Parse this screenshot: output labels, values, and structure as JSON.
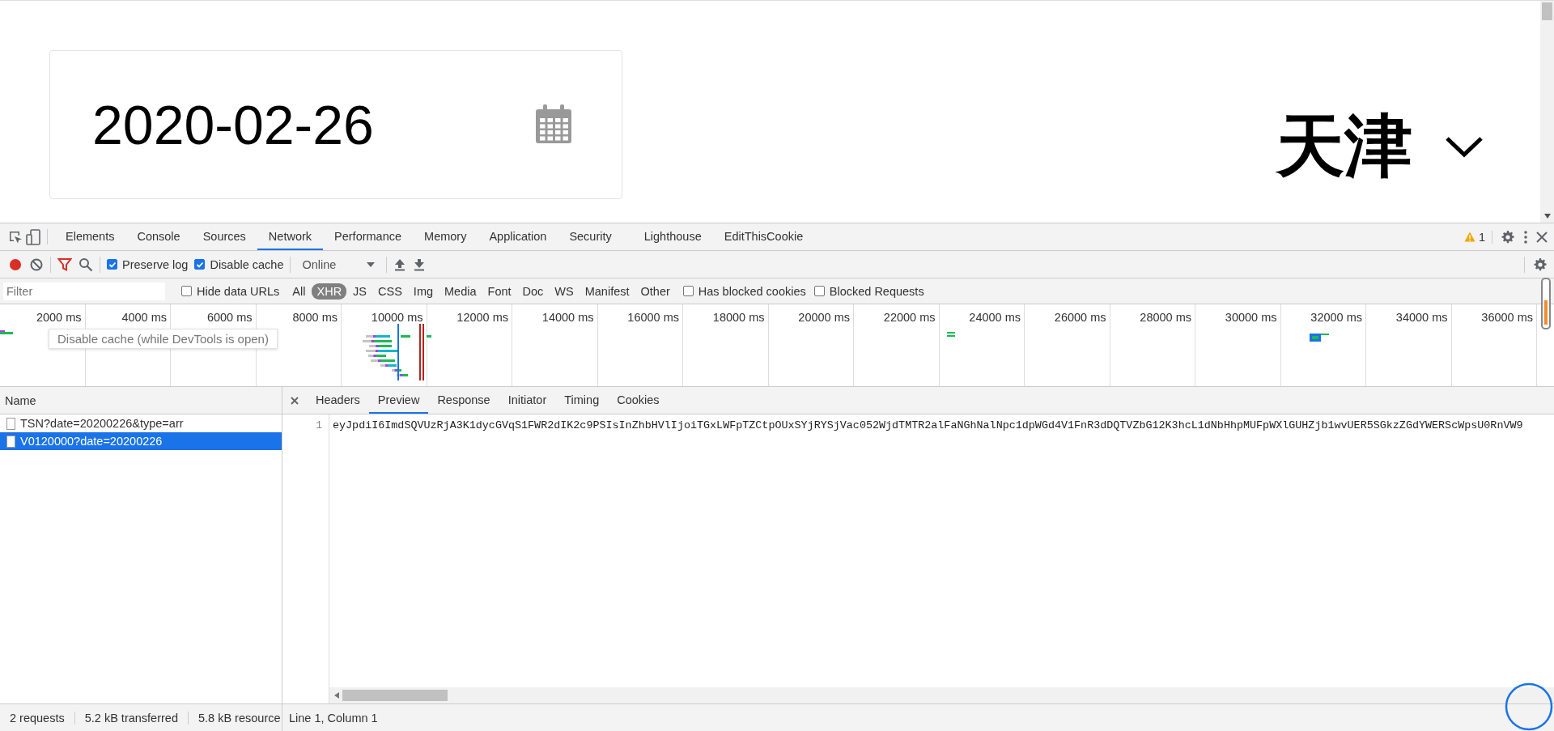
{
  "page": {
    "date_field": {
      "value": "2020-02-26"
    },
    "city_select": {
      "value": "天津"
    }
  },
  "devtools": {
    "tabs": [
      {
        "label": "Elements",
        "selected": false
      },
      {
        "label": "Console",
        "selected": false
      },
      {
        "label": "Sources",
        "selected": false
      },
      {
        "label": "Network",
        "selected": true
      },
      {
        "label": "Performance",
        "selected": false
      },
      {
        "label": "Memory",
        "selected": false
      },
      {
        "label": "Application",
        "selected": false
      },
      {
        "label": "Security",
        "selected": false
      },
      {
        "label": "Lighthouse",
        "selected": false
      },
      {
        "label": "EditThisCookie",
        "selected": false
      }
    ],
    "warning_count": "1",
    "toolbar": {
      "preserve_log": {
        "label": "Preserve log",
        "checked": true
      },
      "disable_cache": {
        "label": "Disable cache",
        "checked": true
      },
      "throttling": "Online"
    },
    "filter": {
      "placeholder": "Filter",
      "hide_data_urls": {
        "label": "Hide data URLs",
        "checked": false
      },
      "types": [
        {
          "label": "All",
          "selected": false
        },
        {
          "label": "XHR",
          "selected": true
        },
        {
          "label": "JS",
          "selected": false
        },
        {
          "label": "CSS",
          "selected": false
        },
        {
          "label": "Img",
          "selected": false
        },
        {
          "label": "Media",
          "selected": false
        },
        {
          "label": "Font",
          "selected": false
        },
        {
          "label": "Doc",
          "selected": false
        },
        {
          "label": "WS",
          "selected": false
        },
        {
          "label": "Manifest",
          "selected": false
        },
        {
          "label": "Other",
          "selected": false
        }
      ],
      "has_blocked_cookies": {
        "label": "Has blocked cookies",
        "checked": false
      },
      "blocked_requests": {
        "label": "Blocked Requests",
        "checked": false
      }
    },
    "tooltip": "Disable cache (while DevTools is open)",
    "overview": {
      "ticks": [
        "2000 ms",
        "4000 ms",
        "6000 ms",
        "8000 ms",
        "10000 ms",
        "12000 ms",
        "14000 ms",
        "16000 ms",
        "18000 ms",
        "20000 ms",
        "22000 ms",
        "24000 ms",
        "26000 ms",
        "28000 ms",
        "30000 ms",
        "32000 ms",
        "34000 ms",
        "36000 ms"
      ]
    },
    "requests": {
      "column": "Name",
      "rows": [
        {
          "name": "TSN?date=20200226&type=arr",
          "selected": false
        },
        {
          "name": "V0120000?date=20200226",
          "selected": true
        }
      ]
    },
    "detail_tabs": [
      {
        "label": "Headers",
        "selected": false
      },
      {
        "label": "Preview",
        "selected": true
      },
      {
        "label": "Response",
        "selected": false
      },
      {
        "label": "Initiator",
        "selected": false
      },
      {
        "label": "Timing",
        "selected": false
      },
      {
        "label": "Cookies",
        "selected": false
      }
    ],
    "preview": {
      "line_number": "1",
      "text": "eyJpdiI6ImdSQVUzRjA3K1dycGVqS1FWR2dIK2c9PSIsInZhbHVlIjoiTGxLWFpTZCtpOUxSYjRYSjVac052WjdTMTR2alFaNGhNalNpc1dpWGd4V1FnR3dDQTVZbG12K3hcL1dNbHhpMUFpWXlGUHZjb1wvUER5SGkzZGdYWERScWpsU0RnVW9"
    },
    "status": {
      "summary": [
        "2 requests",
        "5.2 kB transferred",
        "5.8 kB resource"
      ],
      "cursor": "Line 1, Column 1"
    }
  }
}
